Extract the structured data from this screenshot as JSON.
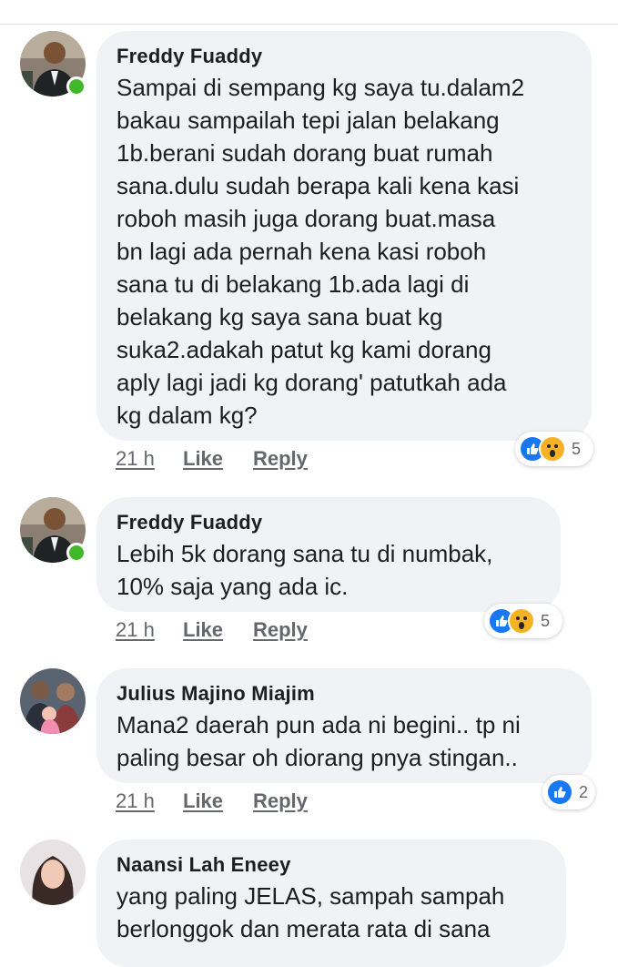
{
  "comments": [
    {
      "author": "Freddy Fuaddy",
      "online": true,
      "text": "Sampai di sempang kg saya tu.dalam2\nbakau sampailah tepi jalan belakang\n1b.berani sudah dorang buat rumah\nsana.dulu sudah berapa kali kena kasi\nroboh masih juga dorang buat.masa\nbn lagi ada pernah kena kasi roboh\nsana tu di belakang 1b.ada lagi di\nbelakang kg saya sana buat kg\nsuka2.adakah patut kg kami dorang\naply lagi jadi kg dorang' patutkah ada\nkg dalam kg?",
      "time": "21 h",
      "like": "Like",
      "reply": "Reply",
      "reactions": [
        "like-icon",
        "wow-icon"
      ],
      "reaction_count": "5"
    },
    {
      "author": "Freddy Fuaddy",
      "online": true,
      "text": "Lebih 5k dorang sana tu di numbak,\n10% saja yang ada ic.",
      "time": "21 h",
      "like": "Like",
      "reply": "Reply",
      "reactions": [
        "like-icon",
        "wow-icon"
      ],
      "reaction_count": "5"
    },
    {
      "author": "Julius Majino Miajim",
      "online": false,
      "text": "Mana2 daerah pun ada ni begini.. tp ni\npaling besar oh diorang pnya stingan..",
      "time": "21 h",
      "like": "Like",
      "reply": "Reply",
      "reactions": [
        "like-icon"
      ],
      "reaction_count": "2"
    },
    {
      "author": "Naansi Lah Eneey",
      "online": false,
      "text": "yang paling JELAS, sampah sampah\nberlonggok dan merata rata di sana"
    }
  ],
  "colors": {
    "bubble": "#f0f2f5",
    "like_blue": "#1877f2",
    "wow_yellow": "#f7b125",
    "online_green": "#42b72a",
    "meta_gray": "#65676b"
  }
}
